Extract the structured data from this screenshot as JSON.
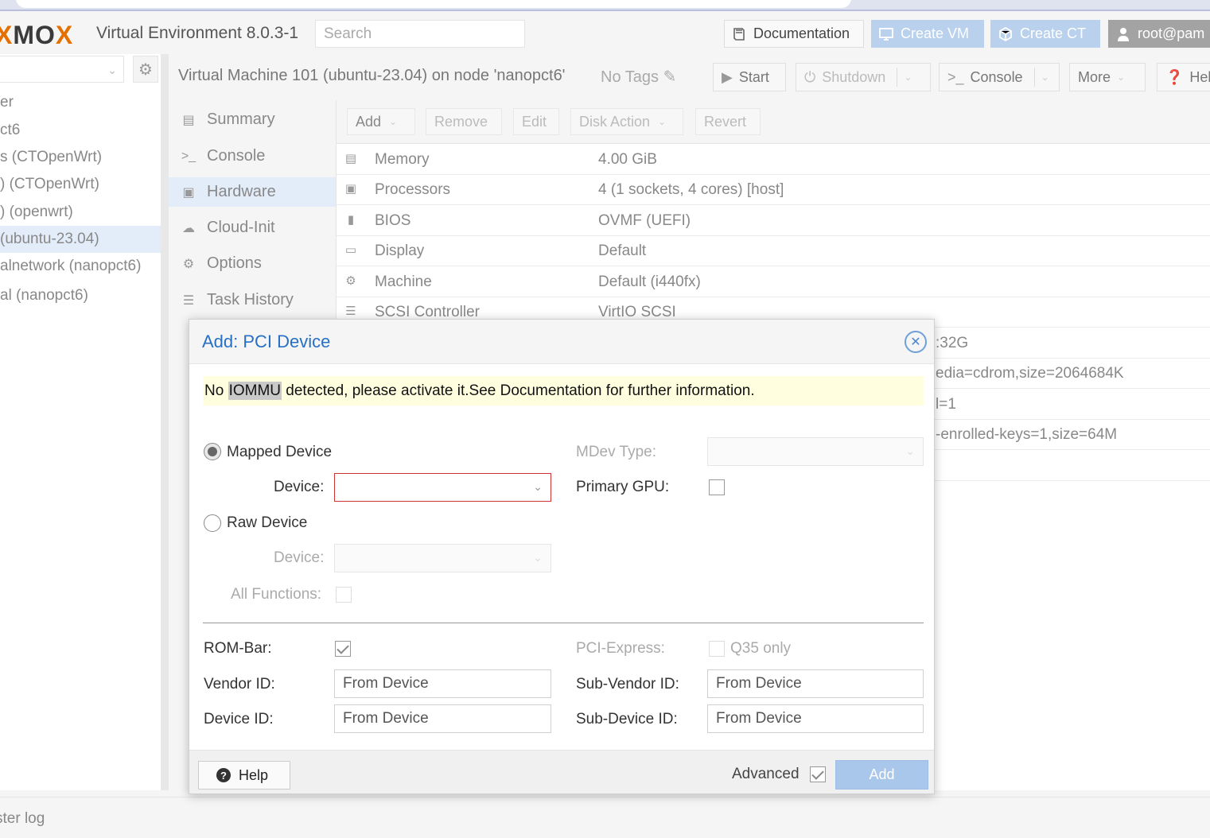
{
  "app": {
    "logo_text": "XMOX",
    "title": "Virtual Environment 8.0.3-1",
    "search_placeholder": "Search",
    "buttons": {
      "documentation": "Documentation",
      "create_vm": "Create VM",
      "create_ct": "Create CT",
      "user": "root@pam"
    }
  },
  "tree": {
    "items": [
      {
        "label": "er",
        "selected": false
      },
      {
        "label": "ct6",
        "selected": false
      },
      {
        "label": "s (CTOpenWrt)",
        "selected": false
      },
      {
        "label": ") (CTOpenWrt)",
        "selected": false
      },
      {
        "label": ") (openwrt)",
        "selected": false
      },
      {
        "label": " (ubuntu-23.04)",
        "selected": true
      },
      {
        "label": "alnetwork (nanopct6)",
        "selected": false
      },
      {
        "label": "al (nanopct6)",
        "selected": false
      }
    ]
  },
  "content": {
    "title": "Virtual Machine 101 (ubuntu-23.04) on node 'nanopct6'",
    "tags": "No Tags",
    "buttons": {
      "start": "Start",
      "shutdown": "Shutdown",
      "console": "Console",
      "more": "More",
      "help": "Hel"
    }
  },
  "nav": {
    "items": [
      {
        "label": "Summary",
        "icon": "book-icon"
      },
      {
        "label": "Console",
        "icon": "terminal-icon"
      },
      {
        "label": "Hardware",
        "icon": "monitor-icon",
        "active": true
      },
      {
        "label": "Cloud-Init",
        "icon": "cloud-icon"
      },
      {
        "label": "Options",
        "icon": "gear-icon"
      },
      {
        "label": "Task History",
        "icon": "list-icon"
      }
    ]
  },
  "hardware": {
    "toolbar": {
      "add": "Add",
      "remove": "Remove",
      "edit": "Edit",
      "disk_action": "Disk Action",
      "revert": "Revert"
    },
    "rows": [
      {
        "key": "Memory",
        "value": "4.00 GiB",
        "icon": "memory-icon"
      },
      {
        "key": "Processors",
        "value": "4 (1 sockets, 4 cores) [host]",
        "icon": "cpu-icon"
      },
      {
        "key": "BIOS",
        "value": "OVMF (UEFI)",
        "icon": "bios-icon"
      },
      {
        "key": "Display",
        "value": "Default",
        "icon": "display-icon"
      },
      {
        "key": "Machine",
        "value": "Default (i440fx)",
        "icon": "machine-icon"
      },
      {
        "key": "SCSI Controller",
        "value": "VirtIO SCSI",
        "icon": "database-icon"
      }
    ],
    "hidden_tails": [
      ":32G",
      "edia=cdrom,size=2064684K",
      "l=1",
      "-enrolled-keys=1,size=64M"
    ]
  },
  "footer": {
    "label": "ster log"
  },
  "dialog": {
    "title": "Add: PCI Device",
    "warning_pre": "No ",
    "warning_highlight": "IOMMU",
    "warning_post": " detected, please activate it.See Documentation for further information.",
    "mapped_device": "Mapped Device",
    "raw_device": "Raw Device",
    "device_label": "Device:",
    "all_functions": "All Functions:",
    "mdev_type": "MDev Type:",
    "primary_gpu": "Primary GPU:",
    "rom_bar": "ROM-Bar:",
    "pci_express": "PCI-Express:",
    "q35_only": "Q35 only",
    "vendor_id": "Vendor ID:",
    "device_id": "Device ID:",
    "sub_vendor_id": "Sub-Vendor ID:",
    "sub_device_id": "Sub-Device ID:",
    "vendor_id_value": "From Device",
    "device_id_value": "From Device",
    "sub_vendor_id_value": "From Device",
    "sub_device_id_value": "From Device",
    "help": "Help",
    "advanced": "Advanced",
    "add": "Add"
  }
}
